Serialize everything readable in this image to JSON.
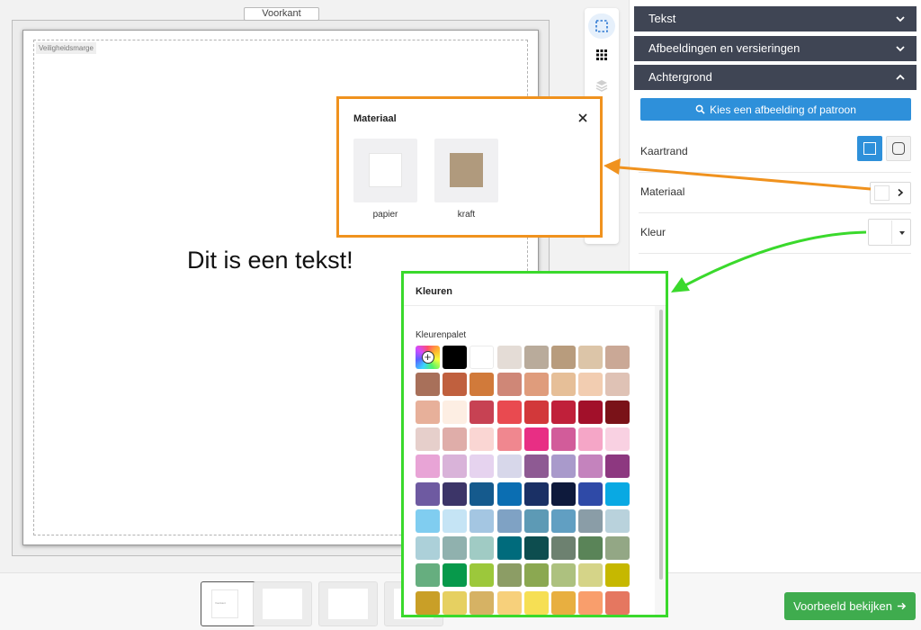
{
  "editor": {
    "face_label": "Voorkant",
    "safety_label": "Veiligheidsmarge",
    "card_text": "Dit is een tekst!"
  },
  "panel": {
    "sections": [
      {
        "label": "Tekst",
        "expanded": false
      },
      {
        "label": "Afbeeldingen en versieringen",
        "expanded": false
      },
      {
        "label": "Achtergrond",
        "expanded": true
      }
    ],
    "pick_button": "Kies een afbeelding of patroon",
    "rows": {
      "border_label": "Kaartrand",
      "material_label": "Materiaal",
      "color_label": "Kleur"
    }
  },
  "material_popup": {
    "title": "Materiaal",
    "options": [
      {
        "label": "papier",
        "color": "#ffffff"
      },
      {
        "label": "kraft",
        "color": "#b09a7d"
      }
    ]
  },
  "colors_popup": {
    "title": "Kleuren",
    "palette_label": "Kleurenpalet",
    "swatches": [
      "#000000",
      "#ffffff",
      "#e4dcd6",
      "#b9ab9b",
      "#b89c7d",
      "#dcc5a8",
      "#caa896",
      "#a8705a",
      "#c0603e",
      "#d17a3a",
      "#cf8777",
      "#df9c7c",
      "#e6bf98",
      "#f2cdb1",
      "#dfc2b5",
      "#e7b09a",
      "#fdeee3",
      "#c74253",
      "#e94a50",
      "#d2383a",
      "#c0203a",
      "#a2102a",
      "#7a1218",
      "#e6cfcb",
      "#dfada9",
      "#fad6d3",
      "#f0878f",
      "#e82e84",
      "#d25c9a",
      "#f5a6c7",
      "#f9d1e2",
      "#e8a4d6",
      "#d9b3d9",
      "#e6d3ef",
      "#d7d7ea",
      "#8e5a93",
      "#a99acb",
      "#c483bd",
      "#8d3880",
      "#6e5aa1",
      "#3c3568",
      "#155a8d",
      "#0b6eb2",
      "#1a3065",
      "#0e1a3c",
      "#2f4aa7",
      "#09a9e3",
      "#80cdf0",
      "#c5e4f5",
      "#a4c6e2",
      "#7fa2c4",
      "#5d9ab5",
      "#619fc2",
      "#8a9da7",
      "#b9d2dc",
      "#acd0d9",
      "#90b1ae",
      "#a0cbc4",
      "#006b7c",
      "#0d4d4f",
      "#6d8170",
      "#5a8458",
      "#93a785",
      "#66ae7f",
      "#07994b",
      "#9cc83b",
      "#8c9d65",
      "#8ba851",
      "#adc17f",
      "#d5d488",
      "#c6b800",
      "#c99f27",
      "#e6d061",
      "#d6b264",
      "#f7d07b",
      "#f6df54",
      "#e8af40",
      "#f99e6c",
      "#e57760"
    ]
  },
  "footer": {
    "preview_button": "Voorbeeld bekijken",
    "thumb_label": "Voorkant"
  }
}
